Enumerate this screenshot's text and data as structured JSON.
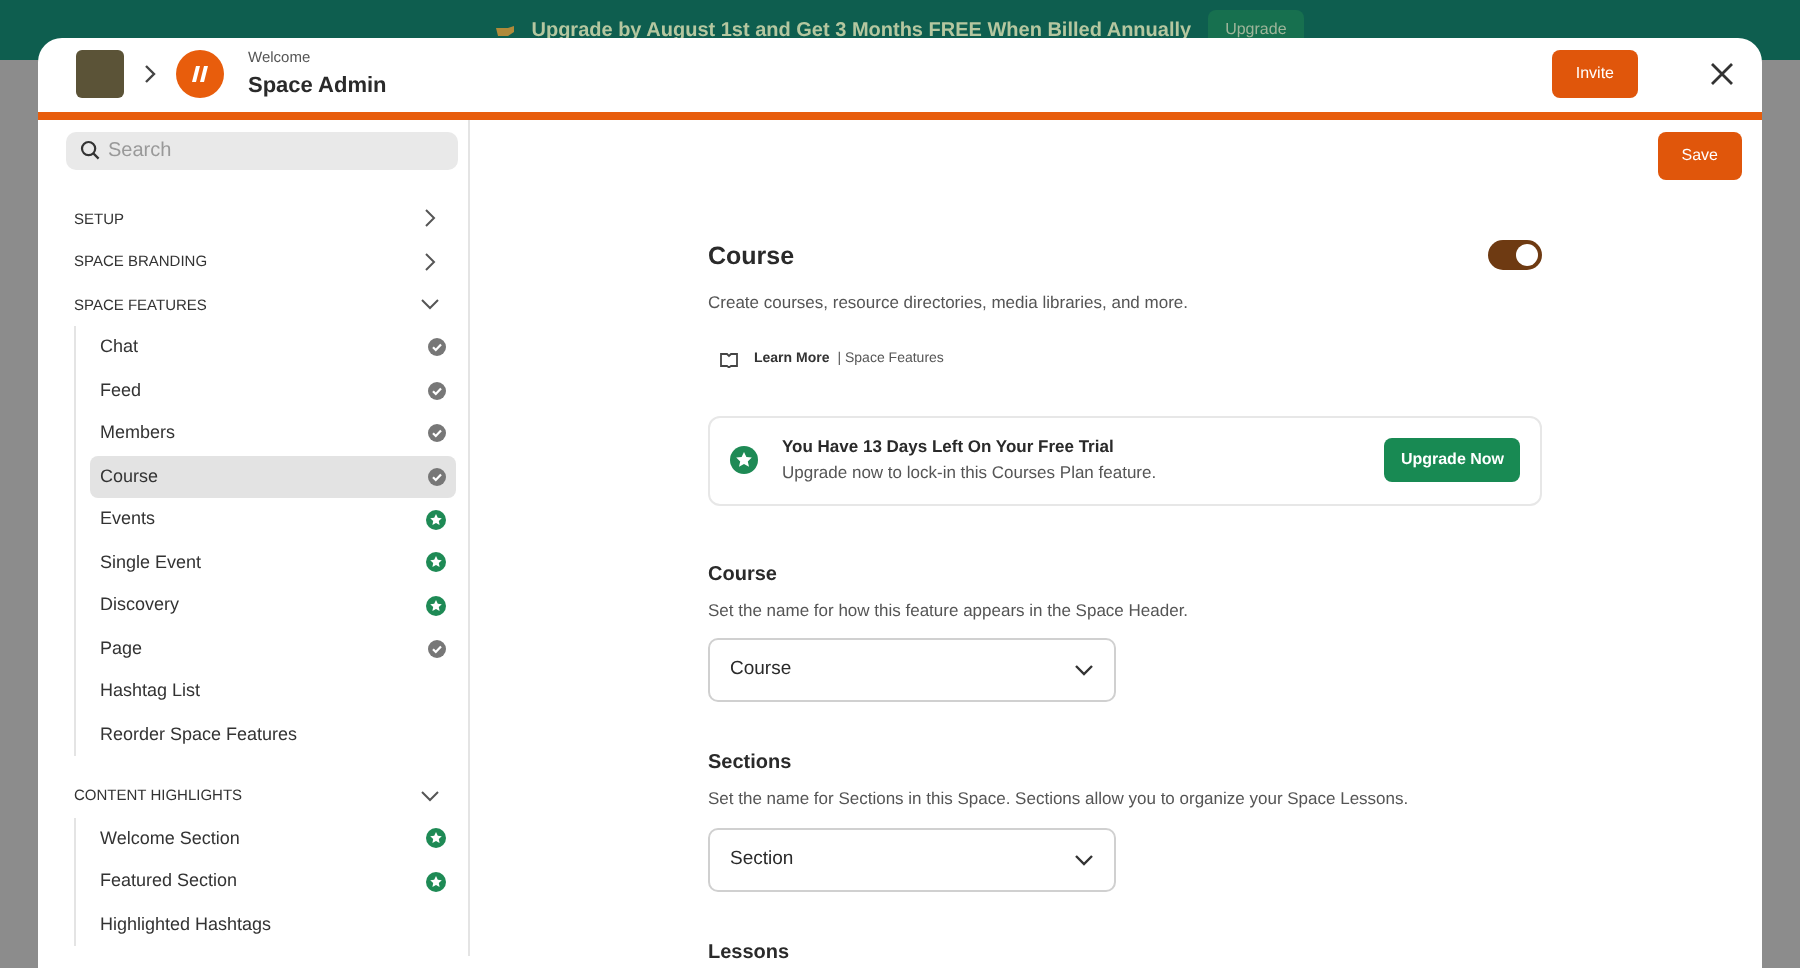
{
  "banner": {
    "text": "Upgrade by August 1st and Get 3 Months FREE When Billed Annually",
    "button": "Upgrade"
  },
  "header": {
    "subtitle": "Welcome",
    "title": "Space Admin",
    "invite_button": "Invite"
  },
  "sidebar": {
    "search": {
      "placeholder": "Search"
    },
    "sections": [
      {
        "label": "SETUP",
        "expanded": false
      },
      {
        "label": "SPACE BRANDING",
        "expanded": false
      },
      {
        "label": "SPACE FEATURES",
        "expanded": true,
        "items": [
          {
            "label": "Chat",
            "selected": false,
            "kind": "included"
          },
          {
            "label": "Feed",
            "selected": false,
            "kind": "included"
          },
          {
            "label": "Members",
            "selected": false,
            "kind": "included"
          },
          {
            "label": "Course",
            "selected": true,
            "kind": "included"
          },
          {
            "label": "Events",
            "selected": false,
            "kind": "premium"
          },
          {
            "label": "Single Event",
            "selected": false,
            "kind": "premium"
          },
          {
            "label": "Discovery",
            "selected": false,
            "kind": "premium"
          },
          {
            "label": "Page",
            "selected": false,
            "kind": "included"
          },
          {
            "label": "Hashtag List",
            "selected": false,
            "kind": "plain"
          },
          {
            "label": "Reorder Space Features",
            "selected": false,
            "kind": "plain"
          }
        ]
      },
      {
        "label": "CONTENT HIGHLIGHTS",
        "expanded": true,
        "items": [
          {
            "label": "Welcome Section",
            "selected": false,
            "kind": "premium"
          },
          {
            "label": "Featured Section",
            "selected": false,
            "kind": "premium"
          },
          {
            "label": "Highlighted Hashtags",
            "selected": false,
            "kind": "plain"
          }
        ]
      }
    ]
  },
  "content": {
    "save_button": "Save",
    "feature": {
      "title": "Course",
      "on": true,
      "description": "Create courses, resource directories, media libraries, and more.",
      "learn_more": "Learn More",
      "learn_more_topic": "| Space Features"
    },
    "trial": {
      "title": "You Have 13 Days Left On Your Free Trial",
      "text": "Upgrade now to lock-in this Courses Plan feature.",
      "button": "Upgrade Now"
    },
    "fields": [
      {
        "label": "Course",
        "description": "Set the name for how this feature appears in the Space Header.",
        "value": "Course"
      },
      {
        "label": "Sections",
        "description": "Set the name for Sections in this Space. Sections allow you to organize your Space Lessons.",
        "value": "Section"
      },
      {
        "label": "Lessons"
      }
    ]
  }
}
